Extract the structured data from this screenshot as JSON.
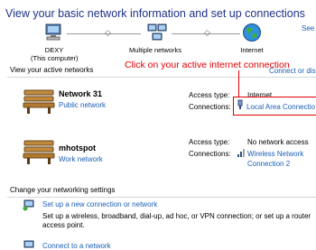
{
  "header": {
    "title": "View your basic network information and set up connections",
    "see_full_map": "See f"
  },
  "map": {
    "computer": {
      "name": "DEXY",
      "subtitle": "(This computer)"
    },
    "multiple_networks": "Multiple networks",
    "internet": "Internet"
  },
  "active_networks": {
    "heading": "View your active networks",
    "connect_link": "Connect or disc",
    "annotation": "Click on your active internet connection",
    "access_type_label": "Access type:",
    "connections_label": "Connections:",
    "networks": [
      {
        "name": "Network 31",
        "type": "Public network",
        "access_type": "Internet",
        "connection": "Local Area Connectio"
      },
      {
        "name": "mhotspot",
        "type": "Work network",
        "access_type": "No network access",
        "connection_line1": "Wireless Network",
        "connection_line2": "Connection 2"
      }
    ]
  },
  "change_settings": {
    "heading": "Change your networking settings",
    "items": [
      {
        "title": "Set up a new connection or network",
        "desc_line1": "Set up a wireless, broadband, dial-up, ad hoc, or VPN connection; or set up a router",
        "desc_line2": "access point."
      },
      {
        "title": "Connect to a network"
      }
    ]
  },
  "colors": {
    "title": "#1e3287",
    "link": "#1a5fb4",
    "annotation": "#e00000"
  }
}
